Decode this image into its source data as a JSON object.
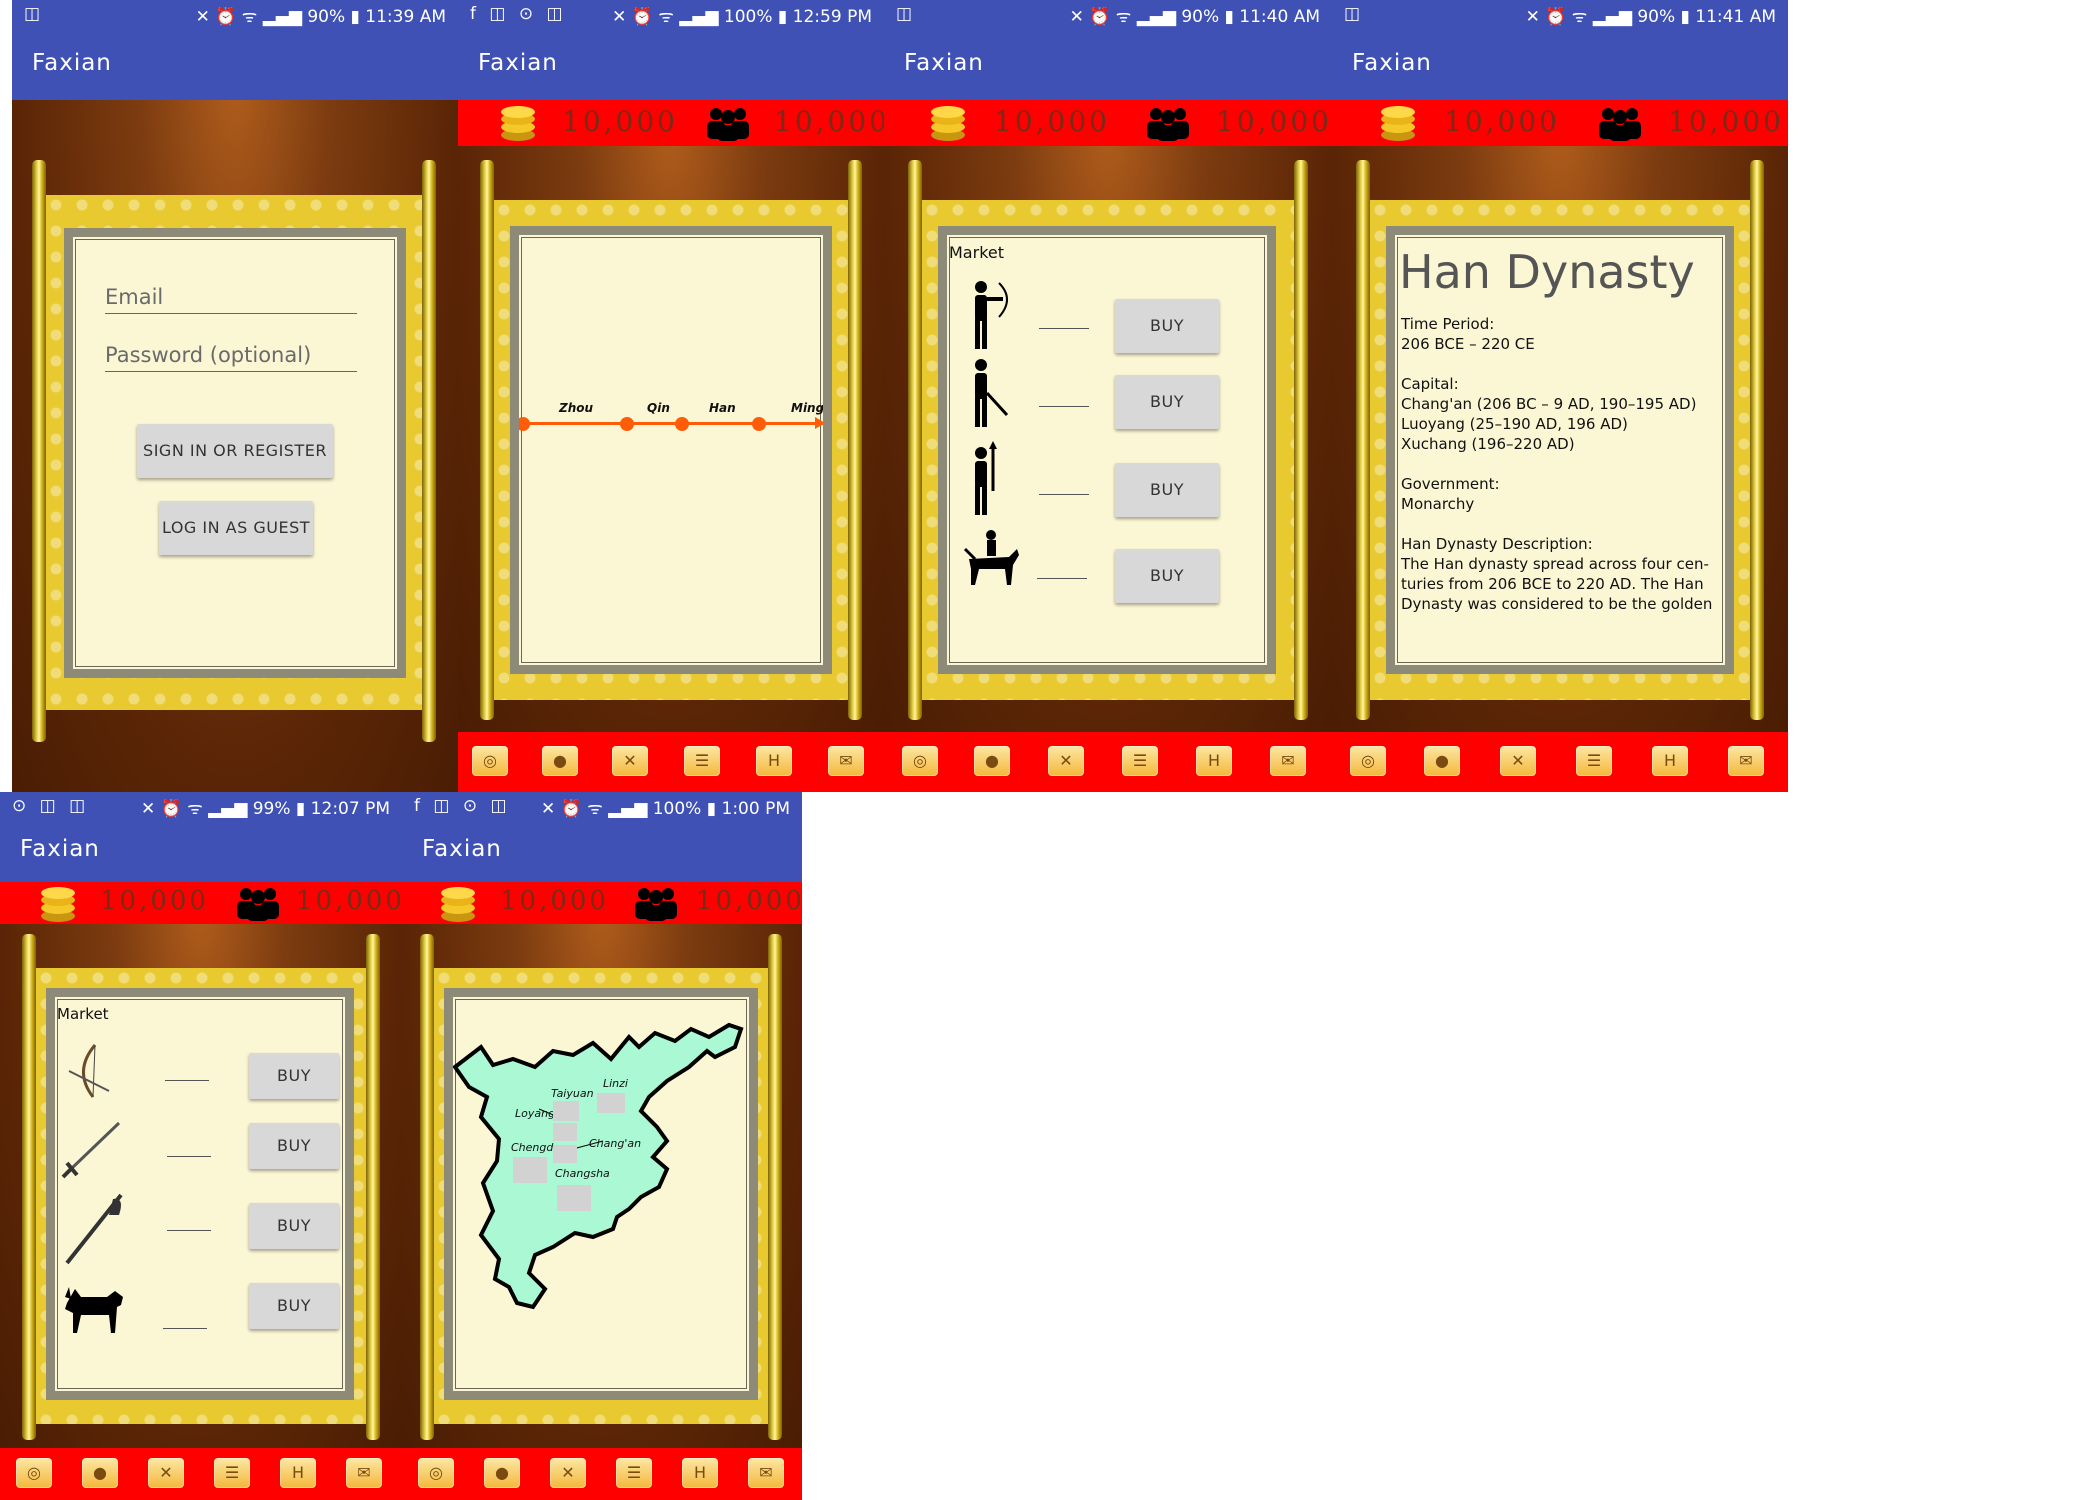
{
  "app_title": "Faxian",
  "status": {
    "s1": {
      "left": "◫",
      "right": "✕ ⏰ ᯤ ▂▄▆ 90% ▮ 11:39 AM"
    },
    "s2": {
      "left": "f ◫ ⊙ ◫",
      "right": "✕ ⏰ ᯤ ▂▄▆ 100% ▮ 12:59 PM"
    },
    "s3": {
      "left": "◫",
      "right": "✕ ⏰ ᯤ ▂▄▆ 90% ▮ 11:40 AM"
    },
    "s4": {
      "left": "◫",
      "right": "✕ ⏰ ᯤ ▂▄▆ 90% ▮ 11:41 AM"
    },
    "s5": {
      "left": "⊙ ◫ ◫",
      "right": "✕ ⏰ ᯤ ▂▄▆ 99% ▮ 12:07 PM"
    },
    "s6": {
      "left": "f ◫ ⊙ ◫",
      "right": "✕ ⏰ ᯤ ▂▄▆ 100% ▮ 1:00 PM"
    }
  },
  "resources": {
    "gold": "10,000",
    "population": "10,000"
  },
  "login": {
    "email_placeholder": "Email",
    "password_placeholder": "Password (optional)",
    "sign_in_label": "SIGN IN OR REGISTER",
    "guest_label": "LOG IN AS GUEST"
  },
  "timeline": {
    "eras": [
      "Zhou",
      "Qin",
      "Han",
      "Ming"
    ]
  },
  "market": {
    "title": "Market",
    "buy_label": "BUY"
  },
  "dynasty": {
    "title": "Han Dynasty",
    "lines": [
      "Time Period:",
      "206 BCE – 220 CE",
      "",
      "Capital:",
      "Chang'an (206 BC – 9 AD, 190–195 AD)",
      "Luoyang (25–190 AD, 196 AD)",
      "Xuchang (196–220 AD)",
      "",
      "Government:",
      "Monarchy",
      "",
      "Han Dynasty Description:",
      "The Han dynasty spread across four cen-",
      "turies from 206 BCE to 220 AD. The Han",
      "Dynasty was considered to be the golden"
    ]
  },
  "map": {
    "cities": [
      "Taiyuan",
      "Linzi",
      "Loyang",
      "Chengdu",
      "Chang'an",
      "Changsha"
    ]
  },
  "nav_icons": [
    "compass-icon",
    "globe-icon",
    "swords-icon",
    "palace-icon",
    "gate-icon",
    "scroll-icon"
  ],
  "colors": {
    "app_bar": "#3f51b5",
    "resource_bar": "#ff0000",
    "parchment": "#fbf6d4",
    "map_land": "#aaf8d4"
  }
}
